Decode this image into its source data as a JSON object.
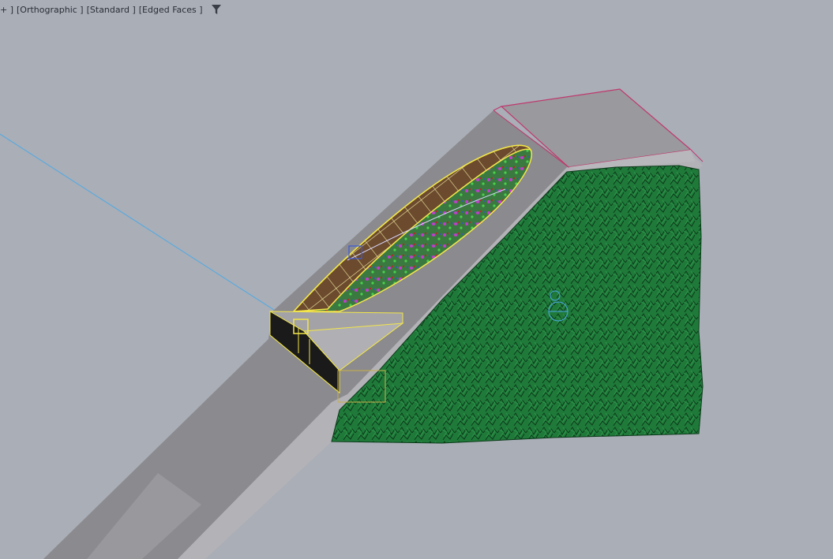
{
  "viewport": {
    "label_prefix": "+ ]",
    "view_mode": "[Orthographic ]",
    "shading_mode": "[Standard ]",
    "display_mode": "[Edged Faces ]",
    "filter_icon": "filter-funnel-icon"
  },
  "colors": {
    "background": "#a9aeb7",
    "road_surface": "#8a898c",
    "road_light": "#9c9ba0",
    "sidewalk": "#b5b4b8",
    "selection_outline": "#c0386e",
    "terrain_green": "#1f7a3a",
    "terrain_wire": "#0e3d1c",
    "canopy_frame": "#f2e64a",
    "canopy_panel": "#7a5a3a",
    "light_line": "#4da9e6"
  }
}
